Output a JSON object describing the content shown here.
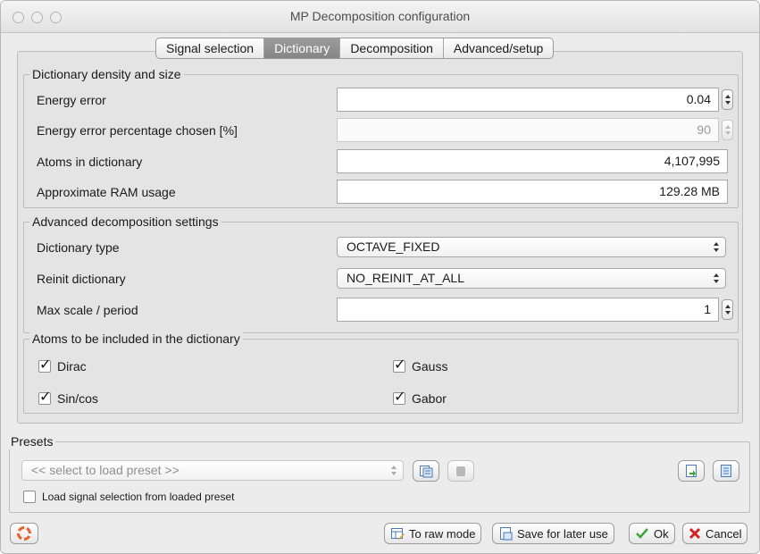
{
  "window": {
    "title": "MP Decomposition configuration"
  },
  "tabs": [
    {
      "label": "Signal selection",
      "active": false
    },
    {
      "label": "Dictionary",
      "active": true
    },
    {
      "label": "Decomposition",
      "active": false
    },
    {
      "label": "Advanced/setup",
      "active": false
    }
  ],
  "density": {
    "legend": "Dictionary density and size",
    "energy_error": {
      "label": "Energy error",
      "value": "0.04"
    },
    "energy_error_pct": {
      "label": "Energy error percentage chosen [%]",
      "value": "90"
    },
    "atoms": {
      "label": "Atoms in dictionary",
      "value": "4,107,995"
    },
    "ram": {
      "label": "Approximate RAM usage",
      "value": "129.28 MB"
    }
  },
  "advanced": {
    "legend": "Advanced decomposition settings",
    "dictionary_type": {
      "label": "Dictionary type",
      "value": "OCTAVE_FIXED"
    },
    "reinit": {
      "label": "Reinit dictionary",
      "value": "NO_REINIT_AT_ALL"
    },
    "max_scale": {
      "label": "Max scale / period",
      "value": "1"
    }
  },
  "atoms_included": {
    "legend": "Atoms to be included in the dictionary",
    "dirac": {
      "label": "Dirac",
      "checked": true
    },
    "gauss": {
      "label": "Gauss",
      "checked": true
    },
    "sincos": {
      "label": "Sin/cos",
      "checked": true
    },
    "gabor": {
      "label": "Gabor",
      "checked": true
    }
  },
  "presets": {
    "legend": "Presets",
    "select_placeholder": "<< select to load preset >>",
    "load_signal_label": "Load signal selection from loaded preset",
    "load_signal_checked": false
  },
  "buttons": {
    "raw_mode": "To raw mode",
    "save_later": "Save for later use",
    "ok": "Ok",
    "cancel": "Cancel"
  },
  "icons": {
    "help": "lifebuoy-icon",
    "raw_mode": "table-edit-icon",
    "save_later": "document-save-icon",
    "ok": "checkmark-icon",
    "cancel": "red-x-icon",
    "preset_save": "preset-save-icon",
    "preset_delete": "preset-delete-icon",
    "preset_import": "preset-import-icon",
    "preset_export": "preset-export-icon"
  },
  "colors": {
    "tab_active": "#8e8e8e",
    "ok_check": "#3aa635",
    "cancel_x": "#d42222",
    "help_ring": "#e8602c"
  }
}
